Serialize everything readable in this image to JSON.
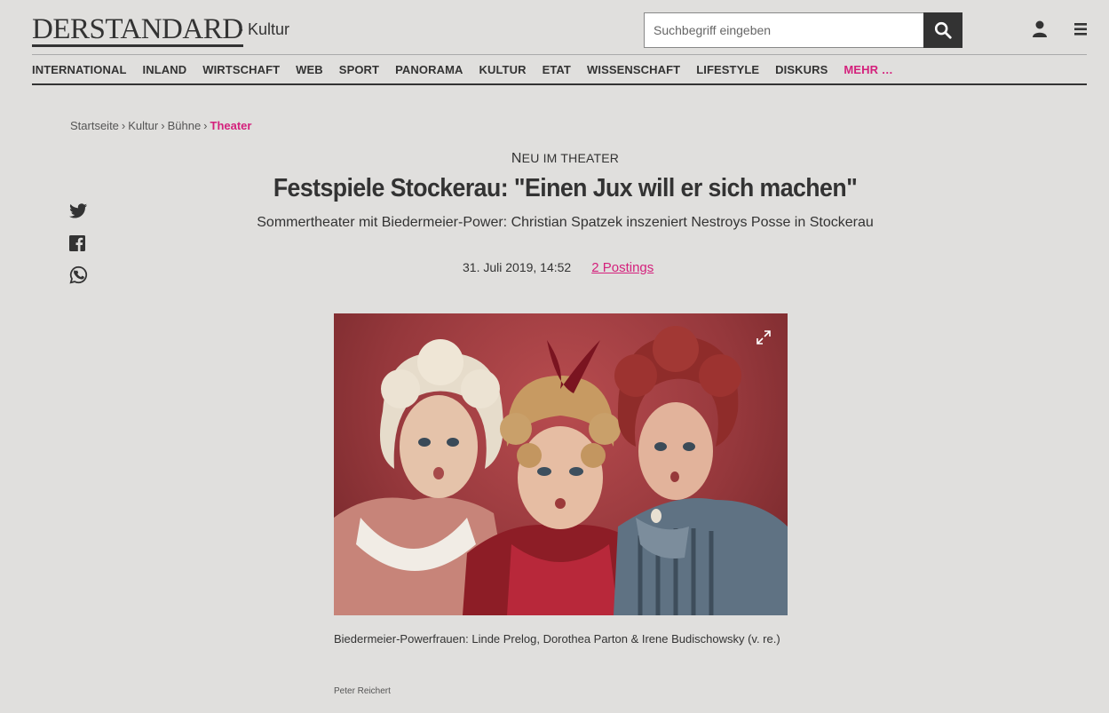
{
  "header": {
    "logo": "DERSTANDARD",
    "section": "› Kultur",
    "search_placeholder": "Suchbegriff eingeben"
  },
  "nav": {
    "items": [
      "INTERNATIONAL",
      "INLAND",
      "WIRTSCHAFT",
      "WEB",
      "SPORT",
      "PANORAMA",
      "KULTUR",
      "ETAT",
      "WISSENSCHAFT",
      "LIFESTYLE",
      "DISKURS"
    ],
    "more": "MEHR …"
  },
  "breadcrumb": {
    "items": [
      "Startseite",
      "Kultur",
      "Bühne"
    ],
    "active": "Theater",
    "separator": "›"
  },
  "article": {
    "kicker_first": "N",
    "kicker_rest": "EU IM THEATER",
    "headline": "Festspiele Stockerau: \"Einen Jux will er sich machen\"",
    "subline": "Sommertheater mit Biedermeier-Power: Christian Spatzek inszeniert Nestroys Posse in Stockerau",
    "date": "31. Juli 2019, 14:52",
    "postings": "2 Postings",
    "caption": "Biedermeier-Powerfrauen: Linde Prelog, Dorothea Parton & Irene Budischowsky (v. re.)",
    "credit": "Peter Reichert"
  },
  "icons": {
    "search": "search-icon",
    "user": "user-icon",
    "menu": "hamburger-menu-icon",
    "twitter": "twitter-icon",
    "facebook": "facebook-icon",
    "whatsapp": "whatsapp-icon",
    "expand": "expand-icon"
  },
  "colors": {
    "accent": "#d4217c",
    "background": "#e0dfdd",
    "text": "#333333"
  }
}
